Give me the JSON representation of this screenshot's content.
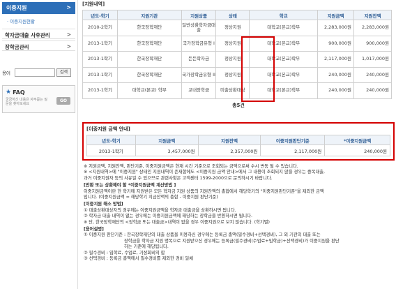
{
  "sidebar": {
    "active_label": "이중지원",
    "active_arrow": ">",
    "sub_label": "· 이중지원현황",
    "items": [
      {
        "label": "학자금대출 사후관리",
        "arrow": ">"
      },
      {
        "label": "장학금관리",
        "arrow": ">"
      }
    ],
    "search": {
      "label": "용어",
      "button": "검색"
    },
    "faq": {
      "title": "FAQ",
      "desc": "궁금하신 내용은 자주묻는 질문을 찾아보세요",
      "go": "GO"
    }
  },
  "history": {
    "title": "[지원내역]",
    "columns": [
      "년도-학기",
      "지원기관",
      "지원상품",
      "상태",
      "학교",
      "지원금액",
      "지원잔액"
    ],
    "rows": [
      [
        "2010-2학기",
        "한국장학재단",
        "일반상환학자금대출",
        "정상지원",
        "대학교(본교)학부",
        "2,283,000원",
        "2,283,000원"
      ],
      [
        "2013-1학기",
        "한국장학재단",
        "국가장학금유형 I",
        "정상지원",
        "대학교(본교)학부",
        "900,000원",
        "900,000원"
      ],
      [
        "2013-1학기",
        "한국장학재단",
        "든든학자금",
        "정상지원",
        "대학교(본교)학부",
        "2,117,000원",
        "1,017,000원"
      ],
      [
        "2013-1학기",
        "한국장학재단",
        "국가장학금유형 II",
        "정상지원",
        "대학교(본교)학부",
        "240,000원",
        "240,000원"
      ],
      [
        "2013-1학기",
        "대학교(본교) 학부",
        "교내장학금",
        "미출상환대상",
        "대학교(본교)학부",
        "240,000원",
        "240,000원"
      ]
    ],
    "total": "총5건"
  },
  "double": {
    "title": "[이중지원 금액 안내]",
    "columns": [
      "년도-학기",
      "지원금액",
      "지원잔액",
      "이중지원판단기준",
      "*이중지원금액"
    ],
    "row": [
      "2013-1학기",
      "3,457,000원",
      "2,357,000원",
      "2,117,000원",
      "240,000원"
    ]
  },
  "notes": [
    {
      "bold": false,
      "text": "※ 지원금액, 지원잔액, 판단기준, 이중지원금액은 현재 시간 기준으로 조회되는 금액으로써 수시 변동 될 수 있습니다."
    },
    {
      "bold": false,
      "text": "※ <지원내역>에 \"이중지원\" 상태인 지원내역이 존재함에도 <이중지원 금액 안내>에서 그 내용이 조회되지 않을 경우는 중복대출,"
    },
    {
      "bold": false,
      "text": "과거 이중지원자 등의 사유일 수 있으므로 관련사항은 고객센터 1599-2000으로 문의하시기 바랍니다."
    },
    {
      "bold": true,
      "text": "[반환 또는 상환해야 할 *이중지원금액 계산방법 ]"
    },
    {
      "bold": false,
      "text": "이중지원금액이란 한 학기에 지원받은 모든 학자금 지원 상품의 지원잔액의 총합에서 해당학기의 \"이중지원판단기준\"을 제외한 금액"
    },
    {
      "bold": false,
      "text": "입니다. (이중지원금액 = 해당학기 지급잔액의 총합 - 이중지원 판단기준)"
    },
    {
      "bold": true,
      "text": "[이중지원 해소 방법]"
    },
    {
      "bold": false,
      "text": "① 대출상환대상자의 경우에는 이중지원금액을 학자금 대출금을 상환하시면 됩니다."
    },
    {
      "bold": false,
      "text": "② 학자금 대출 내역이 없는 경우에는 이중지원금액에 해당하는 장학금을 반환하시면 됩니다."
    },
    {
      "bold": false,
      "text": "※ 단, 한국장학재단의 <장학금 또는 대출금>내역이 없을 경우 이중지원으로 보지 않습니다. (학기별)"
    },
    {
      "bold": true,
      "text": "[용어설명]"
    },
    {
      "bold": false,
      "text": "① 이중지원 판단기준 : 한국장학재단의 대출 상품을 이용하신 경우에는 등록금 총액(필수경비+선택경비), 그 외 기관의 대출 또는"
    },
    {
      "bold": false,
      "text": "장학금을 학자금 지원 명목으로 지원받으신 경우에는 등록금(필수경비(수업료+입학금)+선택경비)가 이중지원을 판단"
    },
    {
      "bold": false,
      "text": "하는 기준에 해당됩니다."
    },
    {
      "bold": false,
      "text": "② 필수경비 : 입학료, 수업료, 기성회비의 합"
    },
    {
      "bold": false,
      "text": "③ 선택경비 : 등록금 총액에서 필수경비를 제외한 경비 일체"
    }
  ]
}
